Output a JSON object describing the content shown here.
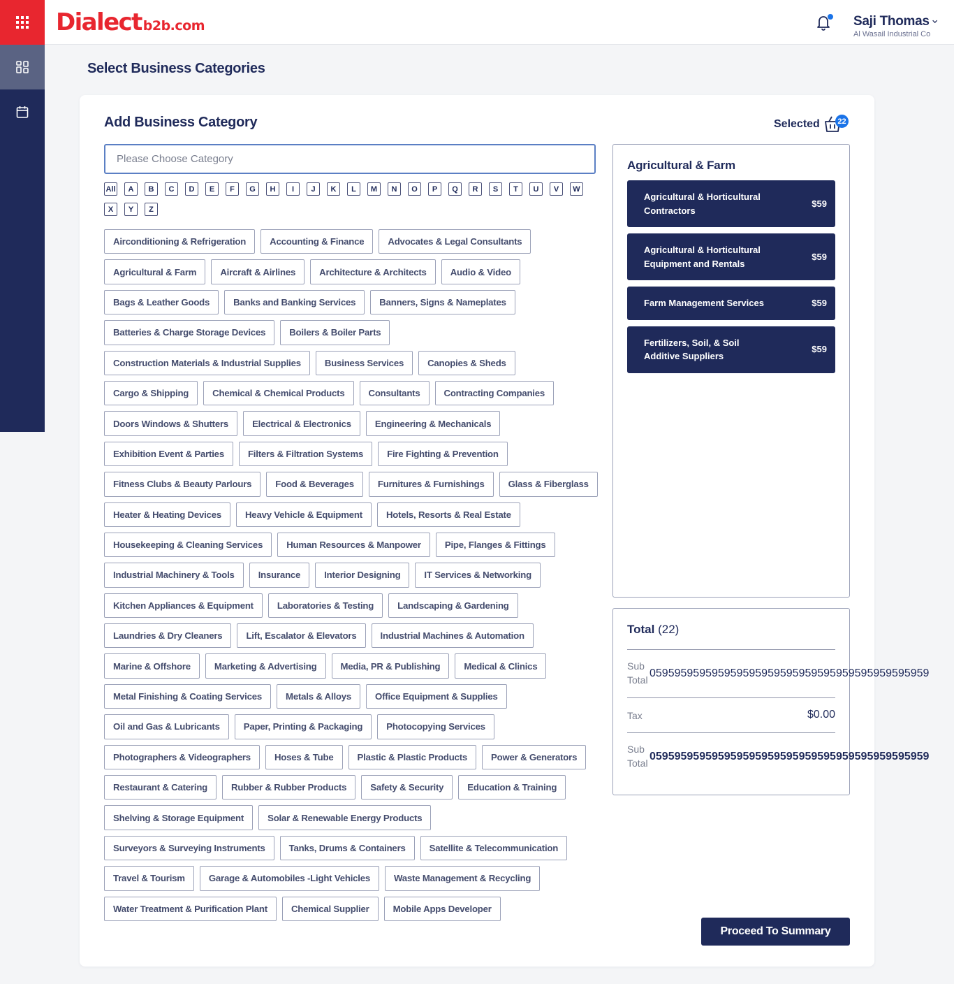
{
  "sidebar": {
    "menu_icon": "apps-grid-icon",
    "items": [
      {
        "icon": "dashboard-icon",
        "active": true
      },
      {
        "icon": "calendar-icon",
        "active": false
      }
    ]
  },
  "header": {
    "logo_main": "Dialect",
    "logo_sub": "b2b.com",
    "user_name": "Saji Thomas",
    "user_company": "Al Wasail Industrial Co"
  },
  "page": {
    "title": "Select Business Categories"
  },
  "card": {
    "title": "Add Business Category",
    "selected_label": "Selected",
    "selected_count": "22",
    "search_placeholder": "Please Choose Category",
    "letters": [
      "All",
      "A",
      "B",
      "C",
      "D",
      "E",
      "F",
      "G",
      "H",
      "I",
      "J",
      "K",
      "L",
      "M",
      "N",
      "O",
      "P",
      "Q",
      "R",
      "S",
      "T",
      "U",
      "V",
      "W",
      "X",
      "Y",
      "Z"
    ],
    "categories": [
      "Airconditioning & Refrigeration",
      "Accounting & Finance",
      "Advocates & Legal Consultants",
      "Agricultural & Farm",
      "Aircraft & Airlines",
      "Architecture & Architects",
      "Audio & Video",
      "Bags & Leather Goods",
      "Banks and Banking Services",
      "Banners, Signs & Nameplates",
      "Batteries & Charge Storage Devices",
      "Boilers & Boiler Parts",
      "Construction Materials & Industrial Supplies",
      "Business Services",
      "Canopies & Sheds",
      "Cargo & Shipping",
      "Chemical & Chemical Products",
      "Consultants",
      "Contracting Companies",
      "Doors Windows & Shutters",
      "Electrical & Electronics",
      "Engineering & Mechanicals",
      "Exhibition Event & Parties",
      "Filters & Filtration Systems",
      "Fire Fighting & Prevention",
      "Fitness Clubs & Beauty Parlours",
      "Food & Beverages",
      "Furnitures & Furnishings",
      "Glass & Fiberglass",
      "Heater & Heating Devices",
      "Heavy Vehicle & Equipment",
      "Hotels, Resorts & Real Estate",
      "Housekeeping & Cleaning Services",
      "Human Resources & Manpower",
      "Pipe, Flanges & Fittings",
      "Industrial Machinery & Tools",
      "Insurance",
      "Interior Designing",
      "IT Services & Networking",
      "Kitchen Appliances & Equipment",
      "Laboratories & Testing",
      "Landscaping & Gardening",
      "Laundries & Dry Cleaners",
      "Lift, Escalator & Elevators",
      "Industrial Machines & Automation",
      "Marine & Offshore",
      "Marketing & Advertising",
      "Media, PR & Publishing",
      "Medical & Clinics",
      "Metal Finishing & Coating Services",
      "Metals & Alloys",
      "Office Equipment & Supplies",
      "Oil and Gas & Lubricants",
      "Paper, Printing & Packaging",
      "Photocopying Services",
      "Photographers & Videographers",
      "Hoses & Tube",
      "Plastic & Plastic Products",
      "Power & Generators",
      "Restaurant & Catering",
      "Rubber & Rubber Products",
      "Safety & Security",
      "Education & Training",
      "Shelving & Storage Equipment",
      "Solar & Renewable Energy Products",
      "Surveyors & Surveying Instruments",
      "Tanks, Drums & Containers",
      "Satellite & Telecommunication",
      "Travel & Tourism",
      "Garage & Automobiles -Light Vehicles",
      "Waste Management & Recycling",
      "Water Treatment & Purification Plant",
      "Chemical Supplier",
      "Mobile Apps Developer"
    ],
    "selected_group": "Agricultural & Farm",
    "selected_items": [
      {
        "name": "Agricultural & Horticultural Contractors",
        "price": "$59"
      },
      {
        "name": "Agricultural & Horticultural Equipment and Rentals",
        "price": "$59"
      },
      {
        "name": "Farm Management Services",
        "price": "$59"
      },
      {
        "name": "Fertilizers, Soil, & Soil Additive Suppliers",
        "price": "$59"
      }
    ],
    "total": {
      "label": "Total",
      "count": "(22)",
      "subtotal_label": "Sub Total",
      "subtotal_value": "059595959595959595959595959595959595959595959",
      "tax_label": "Tax",
      "tax_value": "$0.00",
      "grand_label": "Sub Total",
      "grand_value": "059595959595959595959595959595959595959595959"
    },
    "proceed_label": "Proceed To Summary"
  }
}
